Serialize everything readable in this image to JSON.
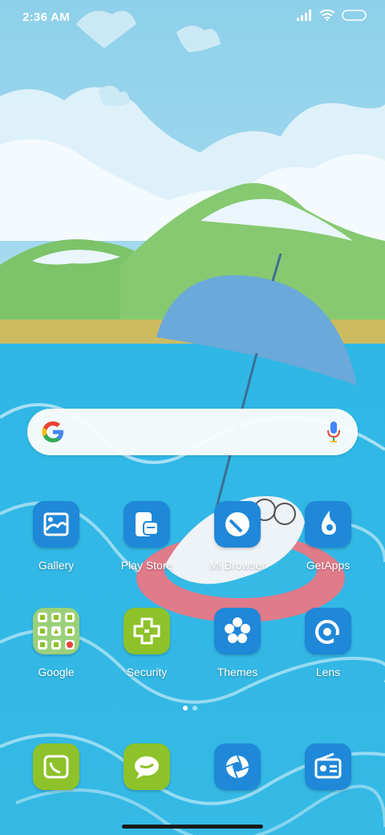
{
  "status_bar": {
    "time": "2:36 AM"
  },
  "search_widget": {
    "google_logo": "google-g-icon",
    "voice_icon": "microphone-icon",
    "colors": {
      "blue": "#4285F4",
      "red": "#EA4335",
      "yellow": "#FBBC05",
      "green": "#34A853"
    }
  },
  "apps": [
    {
      "label": "Gallery",
      "icon": "gallery-icon",
      "color": "#1f88d8"
    },
    {
      "label": "Play Store",
      "icon": "play-store-icon",
      "color": "#1f88d8"
    },
    {
      "label": "Mi Browser",
      "icon": "browser-icon",
      "color": "#1f88d8"
    },
    {
      "label": "GetApps",
      "icon": "getapps-icon",
      "color": "#1f88d8"
    },
    {
      "label": "Google",
      "icon": "google-folder-icon",
      "color": "#8dc22a"
    },
    {
      "label": "Security",
      "icon": "security-icon",
      "color": "#8dc22a"
    },
    {
      "label": "Themes",
      "icon": "themes-icon",
      "color": "#1f88d8"
    },
    {
      "label": "Lens",
      "icon": "lens-icon",
      "color": "#1f88d8"
    }
  ],
  "dock": [
    {
      "icon": "phone-icon",
      "color": "#8dc22a"
    },
    {
      "icon": "messages-icon",
      "color": "#8dc22a"
    },
    {
      "icon": "camera-icon",
      "color": "#1f88d8"
    },
    {
      "icon": "radio-icon",
      "color": "#1f88d8"
    }
  ],
  "page_indicator": {
    "pages": 2,
    "current": 1
  }
}
